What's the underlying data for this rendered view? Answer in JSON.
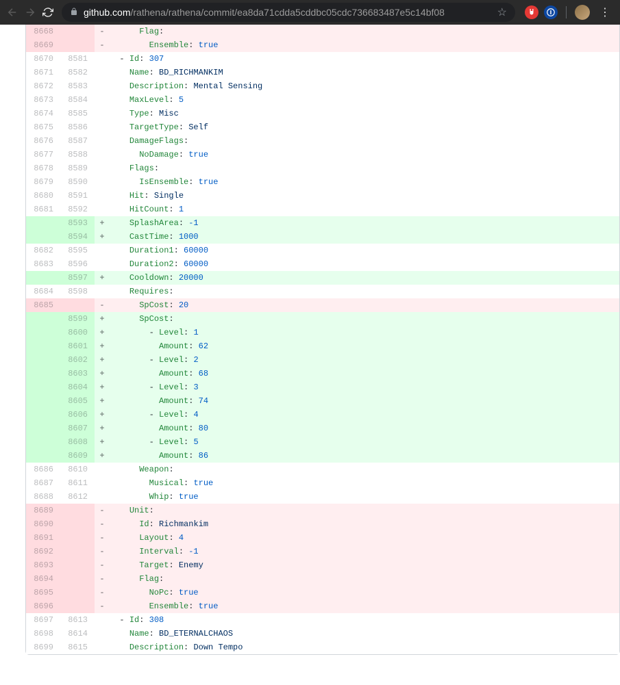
{
  "browser": {
    "url_domain": "github.com",
    "url_path": "/rathena/rathena/commit/ea8da71cdda5cddbc05cdc736683487e5c14bf08"
  },
  "diff": {
    "rows": [
      {
        "type": "deletion",
        "old": "8668",
        "new": "",
        "marker": "-",
        "segs": [
          {
            "t": "      "
          },
          {
            "c": "pl-ent",
            "t": "Flag"
          },
          {
            "t": ":"
          }
        ]
      },
      {
        "type": "deletion",
        "old": "8669",
        "new": "",
        "marker": "-",
        "segs": [
          {
            "t": "        "
          },
          {
            "c": "pl-ent",
            "t": "Ensemble"
          },
          {
            "t": ": "
          },
          {
            "c": "pl-c1",
            "t": "true"
          }
        ]
      },
      {
        "type": "context",
        "old": "8670",
        "new": "8581",
        "marker": "",
        "segs": [
          {
            "t": "  - "
          },
          {
            "c": "pl-ent",
            "t": "Id"
          },
          {
            "t": ": "
          },
          {
            "c": "pl-c1",
            "t": "307"
          }
        ]
      },
      {
        "type": "context",
        "old": "8671",
        "new": "8582",
        "marker": "",
        "segs": [
          {
            "t": "    "
          },
          {
            "c": "pl-ent",
            "t": "Name"
          },
          {
            "t": ": "
          },
          {
            "c": "pl-s",
            "t": "BD_RICHMANKIM"
          }
        ]
      },
      {
        "type": "context",
        "old": "8672",
        "new": "8583",
        "marker": "",
        "segs": [
          {
            "t": "    "
          },
          {
            "c": "pl-ent",
            "t": "Description"
          },
          {
            "t": ": "
          },
          {
            "c": "pl-s",
            "t": "Mental Sensing"
          }
        ]
      },
      {
        "type": "context",
        "old": "8673",
        "new": "8584",
        "marker": "",
        "segs": [
          {
            "t": "    "
          },
          {
            "c": "pl-ent",
            "t": "MaxLevel"
          },
          {
            "t": ": "
          },
          {
            "c": "pl-c1",
            "t": "5"
          }
        ]
      },
      {
        "type": "context",
        "old": "8674",
        "new": "8585",
        "marker": "",
        "segs": [
          {
            "t": "    "
          },
          {
            "c": "pl-ent",
            "t": "Type"
          },
          {
            "t": ": "
          },
          {
            "c": "pl-s",
            "t": "Misc"
          }
        ]
      },
      {
        "type": "context",
        "old": "8675",
        "new": "8586",
        "marker": "",
        "segs": [
          {
            "t": "    "
          },
          {
            "c": "pl-ent",
            "t": "TargetType"
          },
          {
            "t": ": "
          },
          {
            "c": "pl-s",
            "t": "Self"
          }
        ]
      },
      {
        "type": "context",
        "old": "8676",
        "new": "8587",
        "marker": "",
        "segs": [
          {
            "t": "    "
          },
          {
            "c": "pl-ent",
            "t": "DamageFlags"
          },
          {
            "t": ":"
          }
        ]
      },
      {
        "type": "context",
        "old": "8677",
        "new": "8588",
        "marker": "",
        "segs": [
          {
            "t": "      "
          },
          {
            "c": "pl-ent",
            "t": "NoDamage"
          },
          {
            "t": ": "
          },
          {
            "c": "pl-c1",
            "t": "true"
          }
        ]
      },
      {
        "type": "context",
        "old": "8678",
        "new": "8589",
        "marker": "",
        "segs": [
          {
            "t": "    "
          },
          {
            "c": "pl-ent",
            "t": "Flags"
          },
          {
            "t": ":"
          }
        ]
      },
      {
        "type": "context",
        "old": "8679",
        "new": "8590",
        "marker": "",
        "segs": [
          {
            "t": "      "
          },
          {
            "c": "pl-ent",
            "t": "IsEnsemble"
          },
          {
            "t": ": "
          },
          {
            "c": "pl-c1",
            "t": "true"
          }
        ]
      },
      {
        "type": "context",
        "old": "8680",
        "new": "8591",
        "marker": "",
        "segs": [
          {
            "t": "    "
          },
          {
            "c": "pl-ent",
            "t": "Hit"
          },
          {
            "t": ": "
          },
          {
            "c": "pl-s",
            "t": "Single"
          }
        ]
      },
      {
        "type": "context",
        "old": "8681",
        "new": "8592",
        "marker": "",
        "segs": [
          {
            "t": "    "
          },
          {
            "c": "pl-ent",
            "t": "HitCount"
          },
          {
            "t": ": "
          },
          {
            "c": "pl-c1",
            "t": "1"
          }
        ]
      },
      {
        "type": "addition",
        "old": "",
        "new": "8593",
        "marker": "+",
        "segs": [
          {
            "t": "    "
          },
          {
            "c": "pl-ent",
            "t": "SplashArea"
          },
          {
            "t": ": "
          },
          {
            "c": "pl-c1",
            "t": "-1"
          }
        ]
      },
      {
        "type": "addition",
        "old": "",
        "new": "8594",
        "marker": "+",
        "segs": [
          {
            "t": "    "
          },
          {
            "c": "pl-ent",
            "t": "CastTime"
          },
          {
            "t": ": "
          },
          {
            "c": "pl-c1",
            "t": "1000"
          }
        ]
      },
      {
        "type": "context",
        "old": "8682",
        "new": "8595",
        "marker": "",
        "segs": [
          {
            "t": "    "
          },
          {
            "c": "pl-ent",
            "t": "Duration1"
          },
          {
            "t": ": "
          },
          {
            "c": "pl-c1",
            "t": "60000"
          }
        ]
      },
      {
        "type": "context",
        "old": "8683",
        "new": "8596",
        "marker": "",
        "segs": [
          {
            "t": "    "
          },
          {
            "c": "pl-ent",
            "t": "Duration2"
          },
          {
            "t": ": "
          },
          {
            "c": "pl-c1",
            "t": "60000"
          }
        ]
      },
      {
        "type": "addition",
        "old": "",
        "new": "8597",
        "marker": "+",
        "segs": [
          {
            "t": "    "
          },
          {
            "c": "pl-ent",
            "t": "Cooldown"
          },
          {
            "t": ": "
          },
          {
            "c": "pl-c1",
            "t": "20000"
          }
        ]
      },
      {
        "type": "context",
        "old": "8684",
        "new": "8598",
        "marker": "",
        "segs": [
          {
            "t": "    "
          },
          {
            "c": "pl-ent",
            "t": "Requires"
          },
          {
            "t": ":"
          }
        ]
      },
      {
        "type": "deletion",
        "old": "8685",
        "new": "",
        "marker": "-",
        "segs": [
          {
            "t": "      "
          },
          {
            "c": "pl-ent",
            "t": "SpCost"
          },
          {
            "t": ": "
          },
          {
            "c": "pl-c1",
            "t": "20"
          }
        ]
      },
      {
        "type": "addition",
        "old": "",
        "new": "8599",
        "marker": "+",
        "segs": [
          {
            "t": "      "
          },
          {
            "c": "pl-ent",
            "t": "SpCost"
          },
          {
            "t": ":"
          }
        ]
      },
      {
        "type": "addition",
        "old": "",
        "new": "8600",
        "marker": "+",
        "segs": [
          {
            "t": "        - "
          },
          {
            "c": "pl-ent",
            "t": "Level"
          },
          {
            "t": ": "
          },
          {
            "c": "pl-c1",
            "t": "1"
          }
        ]
      },
      {
        "type": "addition",
        "old": "",
        "new": "8601",
        "marker": "+",
        "segs": [
          {
            "t": "          "
          },
          {
            "c": "pl-ent",
            "t": "Amount"
          },
          {
            "t": ": "
          },
          {
            "c": "pl-c1",
            "t": "62"
          }
        ]
      },
      {
        "type": "addition",
        "old": "",
        "new": "8602",
        "marker": "+",
        "segs": [
          {
            "t": "        - "
          },
          {
            "c": "pl-ent",
            "t": "Level"
          },
          {
            "t": ": "
          },
          {
            "c": "pl-c1",
            "t": "2"
          }
        ]
      },
      {
        "type": "addition",
        "old": "",
        "new": "8603",
        "marker": "+",
        "segs": [
          {
            "t": "          "
          },
          {
            "c": "pl-ent",
            "t": "Amount"
          },
          {
            "t": ": "
          },
          {
            "c": "pl-c1",
            "t": "68"
          }
        ]
      },
      {
        "type": "addition",
        "old": "",
        "new": "8604",
        "marker": "+",
        "segs": [
          {
            "t": "        - "
          },
          {
            "c": "pl-ent",
            "t": "Level"
          },
          {
            "t": ": "
          },
          {
            "c": "pl-c1",
            "t": "3"
          }
        ]
      },
      {
        "type": "addition",
        "old": "",
        "new": "8605",
        "marker": "+",
        "segs": [
          {
            "t": "          "
          },
          {
            "c": "pl-ent",
            "t": "Amount"
          },
          {
            "t": ": "
          },
          {
            "c": "pl-c1",
            "t": "74"
          }
        ]
      },
      {
        "type": "addition",
        "old": "",
        "new": "8606",
        "marker": "+",
        "segs": [
          {
            "t": "        - "
          },
          {
            "c": "pl-ent",
            "t": "Level"
          },
          {
            "t": ": "
          },
          {
            "c": "pl-c1",
            "t": "4"
          }
        ]
      },
      {
        "type": "addition",
        "old": "",
        "new": "8607",
        "marker": "+",
        "segs": [
          {
            "t": "          "
          },
          {
            "c": "pl-ent",
            "t": "Amount"
          },
          {
            "t": ": "
          },
          {
            "c": "pl-c1",
            "t": "80"
          }
        ]
      },
      {
        "type": "addition",
        "old": "",
        "new": "8608",
        "marker": "+",
        "segs": [
          {
            "t": "        - "
          },
          {
            "c": "pl-ent",
            "t": "Level"
          },
          {
            "t": ": "
          },
          {
            "c": "pl-c1",
            "t": "5"
          }
        ]
      },
      {
        "type": "addition",
        "old": "",
        "new": "8609",
        "marker": "+",
        "segs": [
          {
            "t": "          "
          },
          {
            "c": "pl-ent",
            "t": "Amount"
          },
          {
            "t": ": "
          },
          {
            "c": "pl-c1",
            "t": "86"
          }
        ]
      },
      {
        "type": "context",
        "old": "8686",
        "new": "8610",
        "marker": "",
        "segs": [
          {
            "t": "      "
          },
          {
            "c": "pl-ent",
            "t": "Weapon"
          },
          {
            "t": ":"
          }
        ]
      },
      {
        "type": "context",
        "old": "8687",
        "new": "8611",
        "marker": "",
        "segs": [
          {
            "t": "        "
          },
          {
            "c": "pl-ent",
            "t": "Musical"
          },
          {
            "t": ": "
          },
          {
            "c": "pl-c1",
            "t": "true"
          }
        ]
      },
      {
        "type": "context",
        "old": "8688",
        "new": "8612",
        "marker": "",
        "segs": [
          {
            "t": "        "
          },
          {
            "c": "pl-ent",
            "t": "Whip"
          },
          {
            "t": ": "
          },
          {
            "c": "pl-c1",
            "t": "true"
          }
        ]
      },
      {
        "type": "deletion",
        "old": "8689",
        "new": "",
        "marker": "-",
        "segs": [
          {
            "t": "    "
          },
          {
            "c": "pl-ent",
            "t": "Unit"
          },
          {
            "t": ":"
          }
        ]
      },
      {
        "type": "deletion",
        "old": "8690",
        "new": "",
        "marker": "-",
        "segs": [
          {
            "t": "      "
          },
          {
            "c": "pl-ent",
            "t": "Id"
          },
          {
            "t": ": "
          },
          {
            "c": "pl-s",
            "t": "Richmankim"
          }
        ]
      },
      {
        "type": "deletion",
        "old": "8691",
        "new": "",
        "marker": "-",
        "segs": [
          {
            "t": "      "
          },
          {
            "c": "pl-ent",
            "t": "Layout"
          },
          {
            "t": ": "
          },
          {
            "c": "pl-c1",
            "t": "4"
          }
        ]
      },
      {
        "type": "deletion",
        "old": "8692",
        "new": "",
        "marker": "-",
        "segs": [
          {
            "t": "      "
          },
          {
            "c": "pl-ent",
            "t": "Interval"
          },
          {
            "t": ": "
          },
          {
            "c": "pl-c1",
            "t": "-1"
          }
        ]
      },
      {
        "type": "deletion",
        "old": "8693",
        "new": "",
        "marker": "-",
        "segs": [
          {
            "t": "      "
          },
          {
            "c": "pl-ent",
            "t": "Target"
          },
          {
            "t": ": "
          },
          {
            "c": "pl-s",
            "t": "Enemy"
          }
        ]
      },
      {
        "type": "deletion",
        "old": "8694",
        "new": "",
        "marker": "-",
        "segs": [
          {
            "t": "      "
          },
          {
            "c": "pl-ent",
            "t": "Flag"
          },
          {
            "t": ":"
          }
        ]
      },
      {
        "type": "deletion",
        "old": "8695",
        "new": "",
        "marker": "-",
        "segs": [
          {
            "t": "        "
          },
          {
            "c": "pl-ent",
            "t": "NoPc"
          },
          {
            "t": ": "
          },
          {
            "c": "pl-c1",
            "t": "true"
          }
        ]
      },
      {
        "type": "deletion",
        "old": "8696",
        "new": "",
        "marker": "-",
        "segs": [
          {
            "t": "        "
          },
          {
            "c": "pl-ent",
            "t": "Ensemble"
          },
          {
            "t": ": "
          },
          {
            "c": "pl-c1",
            "t": "true"
          }
        ]
      },
      {
        "type": "context",
        "old": "8697",
        "new": "8613",
        "marker": "",
        "segs": [
          {
            "t": "  - "
          },
          {
            "c": "pl-ent",
            "t": "Id"
          },
          {
            "t": ": "
          },
          {
            "c": "pl-c1",
            "t": "308"
          }
        ]
      },
      {
        "type": "context",
        "old": "8698",
        "new": "8614",
        "marker": "",
        "segs": [
          {
            "t": "    "
          },
          {
            "c": "pl-ent",
            "t": "Name"
          },
          {
            "t": ": "
          },
          {
            "c": "pl-s",
            "t": "BD_ETERNALCHAOS"
          }
        ]
      },
      {
        "type": "context",
        "old": "8699",
        "new": "8615",
        "marker": "",
        "segs": [
          {
            "t": "    "
          },
          {
            "c": "pl-ent",
            "t": "Description"
          },
          {
            "t": ": "
          },
          {
            "c": "pl-s",
            "t": "Down Tempo"
          }
        ]
      }
    ]
  }
}
